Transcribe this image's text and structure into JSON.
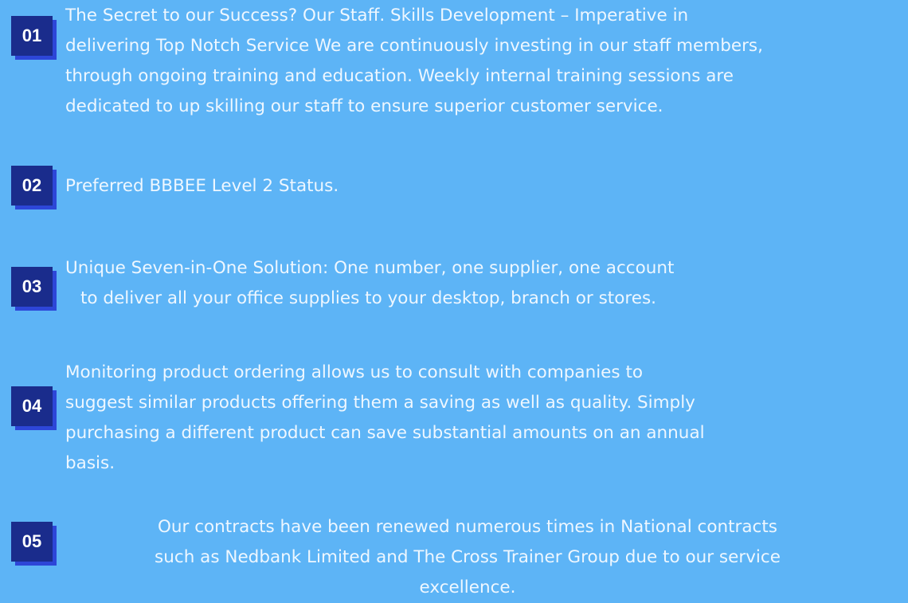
{
  "items": [
    {
      "number": "01",
      "lines": [
        "The Secret to our Success? Our Staff. Skills Development – Imperative in",
        "delivering Top Notch Service We are continuously investing in our staff members,",
        "through ongoing training and education. Weekly internal training sessions are",
        "dedicated to up skilling our staff to ensure superior customer service."
      ]
    },
    {
      "number": "02",
      "lines": [
        "Preferred BBBEE Level 2 Status."
      ]
    },
    {
      "number": "03",
      "lines": [
        "Unique Seven-in-One Solution: One number, one supplier, one account",
        "to deliver all your office supplies to your desktop, branch or stores."
      ]
    },
    {
      "number": "04",
      "lines": [
        "Monitoring product ordering allows us to consult with companies to",
        "suggest similar products offering them a saving as well as quality. Simply",
        "purchasing a different product can save substantial amounts on an annual",
        "basis."
      ]
    },
    {
      "number": "05",
      "lines": [
        "Our contracts have been renewed numerous times in National contracts",
        "such as Nedbank Limited and The Cross Trainer Group due to our service",
        "excellence."
      ]
    }
  ],
  "colors": {
    "background": "#5db4f6",
    "badge": "#1a2c8c",
    "badge_shadow": "#2d46d8",
    "text": "#eef7ff"
  }
}
